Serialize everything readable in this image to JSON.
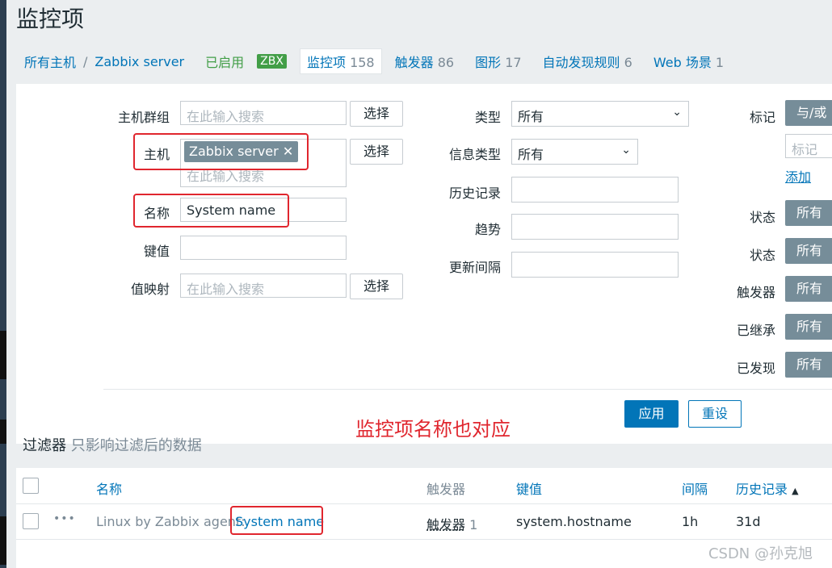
{
  "page": {
    "title": "监控项"
  },
  "breadcrumb": {
    "all_hosts": "所有主机",
    "separator": "/",
    "host": "Zabbix server",
    "enabled": "已启用",
    "zbx": "ZBX",
    "tabs": [
      {
        "label": "监控项",
        "count": "158"
      },
      {
        "label": "触发器",
        "count": "86"
      },
      {
        "label": "图形",
        "count": "17"
      },
      {
        "label": "自动发现规则",
        "count": "6"
      },
      {
        "label": "Web 场景",
        "count": "1"
      }
    ]
  },
  "filter": {
    "host_group_label": "主机群组",
    "host_group_placeholder": "在此输入搜索",
    "select_label": "选择",
    "host_label": "主机",
    "host_tag": "Zabbix server",
    "host_placeholder": "在此输入搜索",
    "name_label": "名称",
    "name_value": "System name",
    "key_label": "键值",
    "valuemap_label": "值映射",
    "valuemap_placeholder": "在此输入搜索",
    "type_label": "类型",
    "type_value": "所有",
    "info_type_label": "信息类型",
    "info_type_value": "所有",
    "history_label": "历史记录",
    "trends_label": "趋势",
    "interval_label": "更新间隔",
    "tags_label": "标记",
    "tags_andor": "与/或",
    "tag_placeholder": "标记",
    "add_link": "添加",
    "state_label": "状态",
    "status_label": "状态",
    "triggers_label": "触发器",
    "inherited_label": "已继承",
    "discovered_label": "已发现",
    "all_value": "所有",
    "apply": "应用",
    "reset": "重设"
  },
  "annotation": "监控项名称也对应",
  "filter_tab": {
    "label": "过滤器",
    "hint": "只影响过滤后的数据"
  },
  "table": {
    "headers": {
      "name": "名称",
      "triggers": "触发器",
      "key": "键值",
      "interval": "间隔",
      "history": "历史记录"
    },
    "sort_arrow": "▲",
    "rows": [
      {
        "menu": "•••",
        "template_prefix": "Linux by Zabbix agent:",
        "name": "System name",
        "triggers": "触发器",
        "trigger_count": "1",
        "key": "system.hostname",
        "interval": "1h",
        "history": "31d"
      }
    ]
  },
  "watermark": "CSDN @孙克旭",
  "colors": {
    "accent": "#0275b8",
    "enabled": "#429e47",
    "highlight": "#e0262e",
    "grey_button": "#768d99"
  }
}
